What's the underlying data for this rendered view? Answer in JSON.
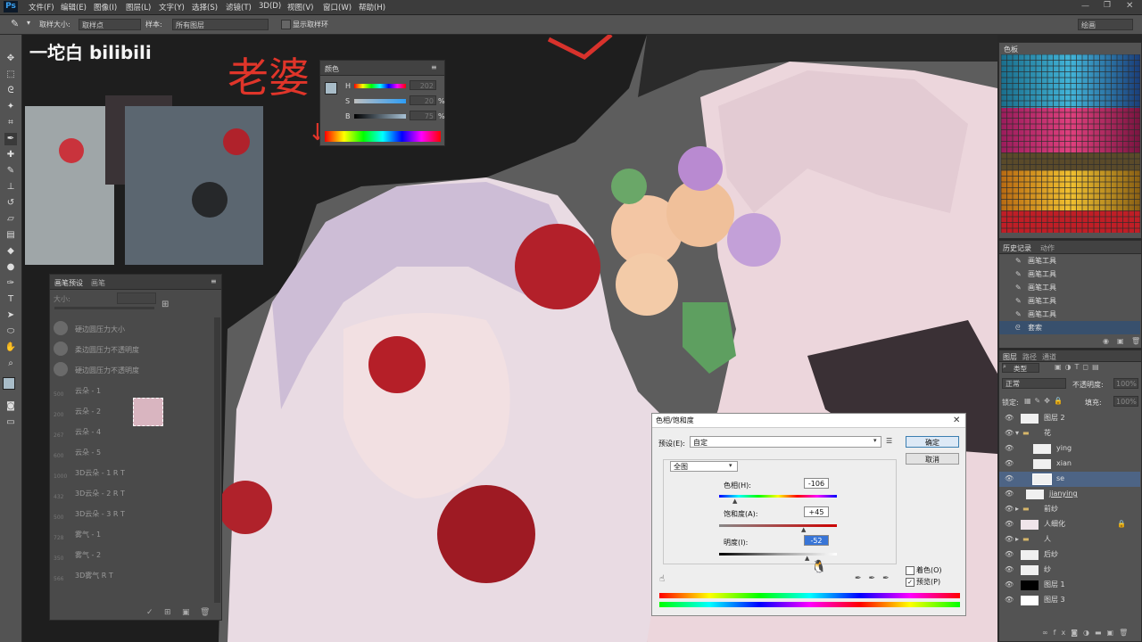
{
  "app": {
    "logo": "Ps"
  },
  "menu": [
    "文件(F)",
    "编辑(E)",
    "图像(I)",
    "图层(L)",
    "文字(Y)",
    "选择(S)",
    "滤镜(T)",
    "3D(D)",
    "视图(V)",
    "窗口(W)",
    "帮助(H)"
  ],
  "options": {
    "sample_size_label": "取样大小:",
    "sample_size_value": "取样点",
    "sample_label": "样本:",
    "sample_value": "所有图层",
    "show_ring": "显示取样环",
    "workspace": "绘画"
  },
  "overlay": {
    "watermark": "一坨白 bilibili",
    "handwriting": "老婆"
  },
  "color_panel": {
    "title": "颜色",
    "h_label": "H",
    "h_value": "202",
    "s_label": "S",
    "s_value": "20",
    "s_unit": "%",
    "b_label": "B",
    "b_value": "75",
    "b_unit": "%"
  },
  "brush_presets": {
    "tab1": "画笔预设",
    "tab2": "画笔",
    "size_label": "大小:",
    "items": [
      {
        "num": "",
        "label": "硬边圆压力大小"
      },
      {
        "num": "",
        "label": "柔边圆压力不透明度"
      },
      {
        "num": "",
        "label": "硬边圆压力不透明度"
      },
      {
        "num": "500",
        "label": "云朵 - 1"
      },
      {
        "num": "200",
        "label": "云朵 - 2"
      },
      {
        "num": "267",
        "label": "云朵 - 4"
      },
      {
        "num": "600",
        "label": "云朵 - 5"
      },
      {
        "num": "1000",
        "label": "3D云朵 - 1 R T"
      },
      {
        "num": "432",
        "label": "3D云朵 - 2 R T"
      },
      {
        "num": "500",
        "label": "3D云朵 - 3 R T"
      },
      {
        "num": "728",
        "label": "雾气 - 1"
      },
      {
        "num": "350",
        "label": "雾气 - 2"
      },
      {
        "num": "566",
        "label": "3D雾气 R T"
      }
    ]
  },
  "swatches_panel": {
    "title": "色板"
  },
  "history_panel": {
    "tab1": "历史记录",
    "tab2": "动作",
    "items": [
      "画笔工具",
      "画笔工具",
      "画笔工具",
      "画笔工具",
      "画笔工具",
      "套索"
    ]
  },
  "layers_panel": {
    "tab1": "图层",
    "tab2": "路径",
    "tab3": "通道",
    "kind_filter": "类型",
    "blend_mode": "正常",
    "opacity_label": "不透明度:",
    "opacity_value": "100%",
    "lock_label": "锁定:",
    "fill_label": "填充:",
    "fill_value": "100%",
    "layers": [
      {
        "name": "图层 2",
        "indent": 0,
        "folder": false,
        "selected": false
      },
      {
        "name": "花",
        "indent": 0,
        "folder": true,
        "selected": false
      },
      {
        "name": "ying",
        "indent": 1,
        "folder": false,
        "selected": false
      },
      {
        "name": "xian",
        "indent": 1,
        "folder": false,
        "selected": false
      },
      {
        "name": "se",
        "indent": 1,
        "folder": false,
        "selected": true
      },
      {
        "name": "jianying",
        "indent": 1,
        "folder": false,
        "selected": false
      },
      {
        "name": "前纱",
        "indent": 0,
        "folder": true,
        "selected": false
      },
      {
        "name": "人细化",
        "indent": 0,
        "folder": false,
        "selected": false
      },
      {
        "name": "人",
        "indent": 0,
        "folder": true,
        "selected": false
      },
      {
        "name": "后纱",
        "indent": 0,
        "folder": false,
        "selected": false
      },
      {
        "name": "纱",
        "indent": 0,
        "folder": false,
        "selected": false
      },
      {
        "name": "图层 1",
        "indent": 0,
        "folder": false,
        "selected": false
      },
      {
        "name": "图层 3",
        "indent": 0,
        "folder": false,
        "selected": false
      }
    ]
  },
  "hue_dialog": {
    "title": "色相/饱和度",
    "preset_label": "预设(E):",
    "preset_value": "自定",
    "ok": "确定",
    "cancel": "取消",
    "channel": "全图",
    "hue_label": "色相(H):",
    "hue_value": "-106",
    "sat_label": "饱和度(A):",
    "sat_value": "+45",
    "light_label": "明度(I):",
    "light_value": "-52",
    "colorize": "着色(O)",
    "preview": "预览(P)",
    "colorize_checked": false,
    "preview_checked": true
  }
}
